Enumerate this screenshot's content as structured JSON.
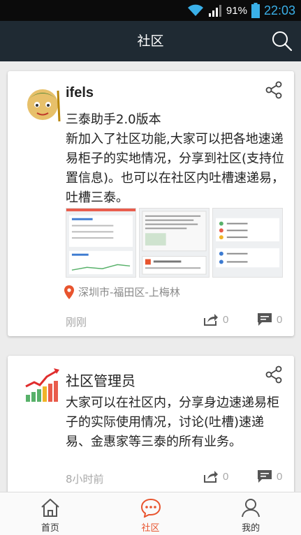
{
  "status_bar": {
    "battery": "91%",
    "time": "22:03"
  },
  "header": {
    "title": "社区"
  },
  "posts": [
    {
      "author": "ifels",
      "text": "三泰助手2.0版本\n新加入了社区功能,大家可以把各地速递易柜子的实地情况，分享到社区(支持位置信息)。也可以在社区内吐槽速递易，吐槽三泰。",
      "location": "深圳市-福田区-上梅林",
      "time": "刚刚",
      "shares": "0",
      "comments": "0"
    },
    {
      "author": "社区管理员",
      "text": "大家可以在社区内，分享身边速递易柜子的实际使用情况，讨论(吐槽)速递易、金惠家等三泰的所有业务。",
      "time": "8小时前",
      "shares": "0",
      "comments": "0"
    }
  ],
  "nav": {
    "items": [
      {
        "label": "首页",
        "icon": "home-icon"
      },
      {
        "label": "社区",
        "icon": "chat-icon"
      },
      {
        "label": "我的",
        "icon": "user-icon"
      }
    ]
  },
  "colors": {
    "accent": "#e8542e",
    "app_bar": "#1f2a33",
    "status_time": "#3ab0e8"
  }
}
